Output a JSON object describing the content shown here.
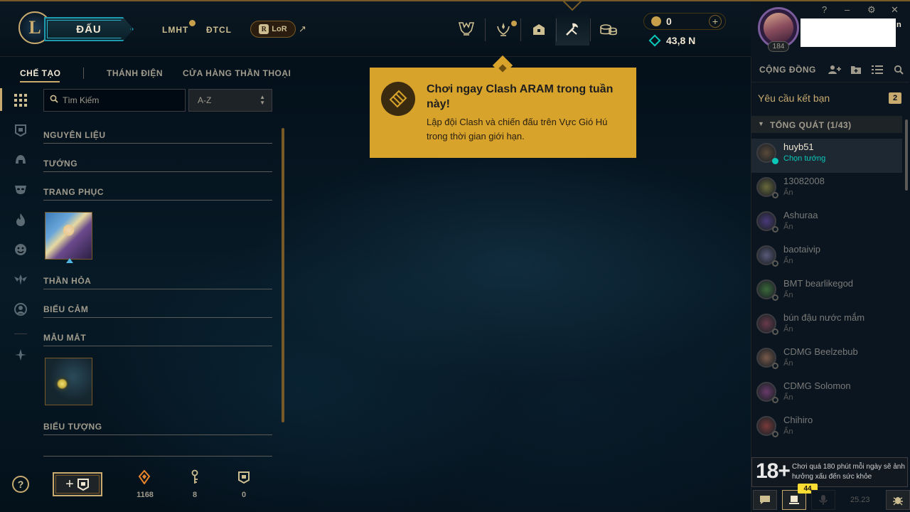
{
  "colors": {
    "gold": "#c8aa6e",
    "popup_bg": "#d8a32b",
    "online": "#0ac8b9",
    "notification_badge": "#ffdd33"
  },
  "header": {
    "play_label": "ĐẤU",
    "games": [
      {
        "label": "LMHT",
        "has_notification": true
      },
      {
        "label": "ĐTCL",
        "has_notification": false
      }
    ],
    "lor_label": "LoR",
    "lor_mark": "R",
    "external_link_glyph": "↗",
    "nav_icons": [
      "trophy-icon",
      "mastery-icon",
      "loot-chest-icon",
      "crafting-icon",
      "store-coins-icon"
    ],
    "currency": {
      "rp": "0",
      "blue_essence": "43,8 N",
      "add_label": "+"
    }
  },
  "profile": {
    "level": "184",
    "name_tail": "n"
  },
  "window_controls": [
    "?",
    "–",
    "⚙",
    "✕"
  ],
  "subnav": {
    "tabs": [
      {
        "label": "CHẾ TẠO",
        "active": true
      },
      {
        "label": "THÁNH ĐIỆN",
        "active": false
      },
      {
        "label": "CỬA HÀNG THẦN THOẠI",
        "active": false
      }
    ]
  },
  "sidebar_icons": [
    "grid-icon",
    "chest-icon",
    "helmet-icon",
    "mask-icon",
    "flame-icon",
    "emote-icon",
    "ward-icon",
    "profile-icon",
    "eternals-icon"
  ],
  "filter": {
    "search_placeholder": "Tìm Kiếm",
    "sort_value": "A-Z"
  },
  "categories": [
    {
      "title": "NGUYÊN LIỆU"
    },
    {
      "title": "TƯỚNG"
    },
    {
      "title": "TRANG PHỤC"
    },
    {
      "title": "THẦN HỎA"
    },
    {
      "title": "BIỂU CẢM"
    },
    {
      "title": "MẪU MẮT"
    },
    {
      "title": "BIỂU TƯỢNG"
    }
  ],
  "footer": {
    "help_label": "?",
    "add_label": "+",
    "stats": [
      {
        "icon": "orange-essence-icon",
        "value": "1168"
      },
      {
        "icon": "key-icon",
        "value": "8"
      },
      {
        "icon": "chest-icon",
        "value": "0"
      }
    ]
  },
  "popup": {
    "title": "Chơi ngay Clash ARAM trong tuần này!",
    "body": "Lập đội Clash và chiến đấu trên Vực Gió Hú trong thời gian giới hạn."
  },
  "social": {
    "title": "CỘNG ĐỒNG",
    "friend_requests_label": "Yêu cầu kết bạn",
    "friend_requests_count": "2",
    "group_title": "TỔNG QUÁT (1/43)",
    "friends": [
      {
        "name": "huyb51",
        "status": "Chọn tướng",
        "online": true,
        "color": "#5a4a3a"
      },
      {
        "name": "13082008",
        "status": "Ẩn",
        "online": false,
        "color": "#6a6a3a"
      },
      {
        "name": "Ashuraa",
        "status": "Ẩn",
        "online": false,
        "color": "#4a3a7a"
      },
      {
        "name": "baotaivip",
        "status": "Ẩn",
        "online": false,
        "color": "#5a5a7a"
      },
      {
        "name": "BMT bearlikegod",
        "status": "Ẩn",
        "online": false,
        "color": "#3a6a3a"
      },
      {
        "name": "bún đậu nước mắm",
        "status": "Ẩn",
        "online": false,
        "color": "#6a3a4a"
      },
      {
        "name": "CDMG Beelzebub",
        "status": "Ẩn",
        "online": false,
        "color": "#7a5a4a"
      },
      {
        "name": "CDMG Solomon",
        "status": "Ẩn",
        "online": false,
        "color": "#6a3a6a"
      },
      {
        "name": "Chihiro",
        "status": "Ẩn",
        "online": false,
        "color": "#7a3a3a"
      }
    ]
  },
  "age_warning": {
    "rating": "18+",
    "text": "Chơi quá 180 phút mỗi ngày sẽ ảnh hưởng xấu đến sức khỏe"
  },
  "bottom_bar": {
    "badge": "44",
    "version": "25.23"
  }
}
